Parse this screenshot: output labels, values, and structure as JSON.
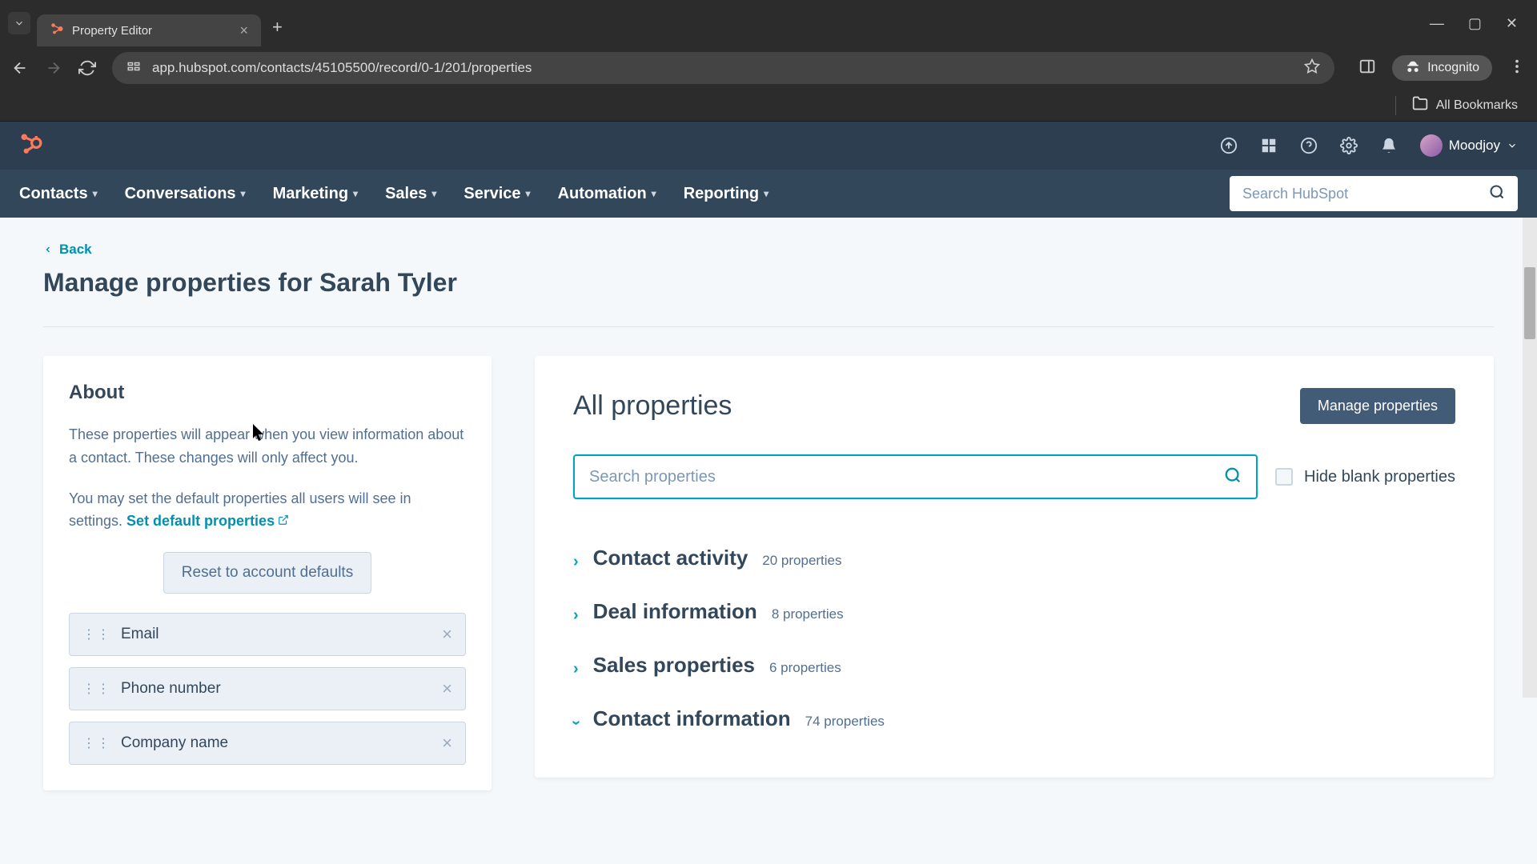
{
  "browser": {
    "tab_title": "Property Editor",
    "url": "app.hubspot.com/contacts/45105500/record/0-1/201/properties",
    "incognito_label": "Incognito",
    "all_bookmarks": "All Bookmarks"
  },
  "header": {
    "username": "Moodjoy"
  },
  "nav": {
    "items": [
      "Contacts",
      "Conversations",
      "Marketing",
      "Sales",
      "Service",
      "Automation",
      "Reporting"
    ],
    "search_placeholder": "Search HubSpot"
  },
  "page": {
    "back_label": "Back",
    "title": "Manage properties for Sarah Tyler"
  },
  "about": {
    "heading": "About",
    "paragraph1": "These properties will appear when you view information about a contact. These changes will only affect you.",
    "paragraph2_a": "You may set the default properties all users will see in settings. ",
    "set_defaults_link": "Set default properties",
    "reset_button": "Reset to account defaults",
    "properties": [
      {
        "label": "Email"
      },
      {
        "label": "Phone number"
      },
      {
        "label": "Company name"
      }
    ]
  },
  "all_properties": {
    "title": "All properties",
    "manage_button": "Manage properties",
    "search_placeholder": "Search properties",
    "hide_blank_label": "Hide blank properties",
    "groups": [
      {
        "name": "Contact activity",
        "count": "20 properties",
        "expanded": false
      },
      {
        "name": "Deal information",
        "count": "8 properties",
        "expanded": false
      },
      {
        "name": "Sales properties",
        "count": "6 properties",
        "expanded": false
      },
      {
        "name": "Contact information",
        "count": "74 properties",
        "expanded": true
      }
    ]
  }
}
